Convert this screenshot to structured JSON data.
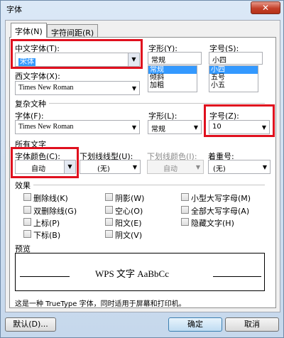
{
  "window": {
    "title": "字体",
    "close_glyph": "✕"
  },
  "tabs": [
    {
      "label": "字体(N)",
      "active": true
    },
    {
      "label": "字符间距(R)",
      "active": false
    }
  ],
  "chinese_font": {
    "label": "中文字体(T):",
    "value": "宋体"
  },
  "western_font": {
    "label": "西文字体(X):",
    "value": "Times New Roman"
  },
  "font_style": {
    "label": "字形(Y):",
    "value": "常规",
    "options": [
      "常规",
      "倾斜",
      "加粗"
    ],
    "selected_index": 0
  },
  "font_size": {
    "label": "字号(S):",
    "value": "小四",
    "options": [
      "小四",
      "五号",
      "小五"
    ],
    "selected_index": 0
  },
  "complex": {
    "section_label": "复杂文种",
    "font_label": "字体(F):",
    "font_value": "Times New Roman",
    "style_label": "字形(L):",
    "style_value": "常规",
    "size_label": "字号(Z):",
    "size_value": "10"
  },
  "all_text": {
    "section_label": "所有文字",
    "color_label": "字体颜色(C):",
    "color_value": "自动",
    "underline_label": "下划线线型(U):",
    "underline_value": "(无)",
    "underline_color_label": "下划线颜色(I):",
    "underline_color_value": "自动",
    "emphasis_label": "着重号:",
    "emphasis_value": "(无)"
  },
  "effects": {
    "section_label": "效果",
    "items": [
      {
        "label": "删除线(K)",
        "checked": false
      },
      {
        "label": "双删除线(G)",
        "checked": false
      },
      {
        "label": "上标(P)",
        "checked": false
      },
      {
        "label": "下标(B)",
        "checked": false
      },
      {
        "label": "阴影(W)",
        "checked": false
      },
      {
        "label": "空心(O)",
        "checked": false
      },
      {
        "label": "阳文(E)",
        "checked": false
      },
      {
        "label": "阴文(V)",
        "checked": false
      },
      {
        "label": "小型大写字母(M)",
        "checked": false
      },
      {
        "label": "全部大写字母(A)",
        "checked": false
      },
      {
        "label": "隐藏文字(H)",
        "checked": false
      }
    ]
  },
  "preview": {
    "section_label": "预览",
    "sample_text": "WPS 文字 AaBbCc",
    "description": "这是一种 TrueType 字体，同时适用于屏幕和打印机。"
  },
  "buttons": {
    "default": "默认(D)...",
    "ok": "确定",
    "cancel": "取消"
  },
  "colors": {
    "highlight": "#e0101e",
    "selection": "#3399ff"
  }
}
